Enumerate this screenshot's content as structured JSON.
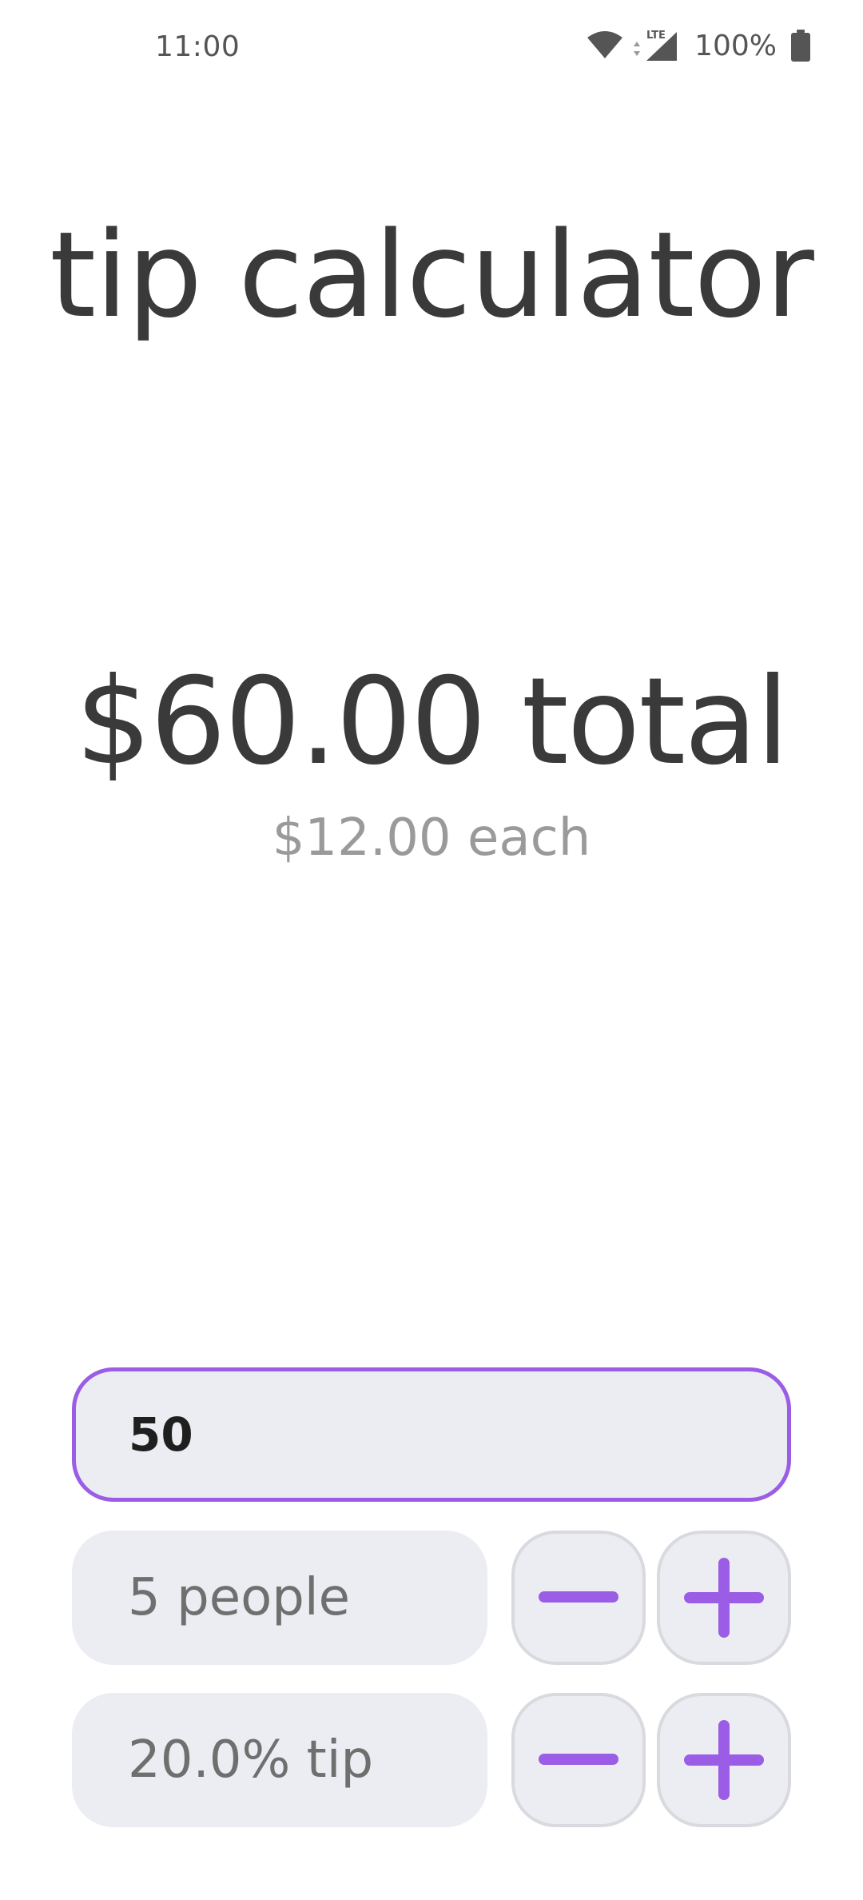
{
  "status_bar": {
    "time": "11:00",
    "network_label": "LTE",
    "battery": "100%",
    "icons": [
      "wifi-icon",
      "cellular-lte-icon",
      "battery-icon"
    ]
  },
  "app": {
    "title": "tip calculator"
  },
  "result": {
    "total": "$60.00 total",
    "each": "$12.00 each"
  },
  "bill": {
    "value": "50"
  },
  "people": {
    "label": "5 people",
    "decrement_icon": "minus-icon",
    "increment_icon": "plus-icon"
  },
  "tip": {
    "label": "20.0% tip",
    "decrement_icon": "minus-icon",
    "increment_icon": "plus-icon"
  },
  "colors": {
    "accent": "#9b5de5",
    "field_background": "#ecedf2",
    "text_primary": "#3a3a3a",
    "text_secondary": "#9a9a9a"
  }
}
